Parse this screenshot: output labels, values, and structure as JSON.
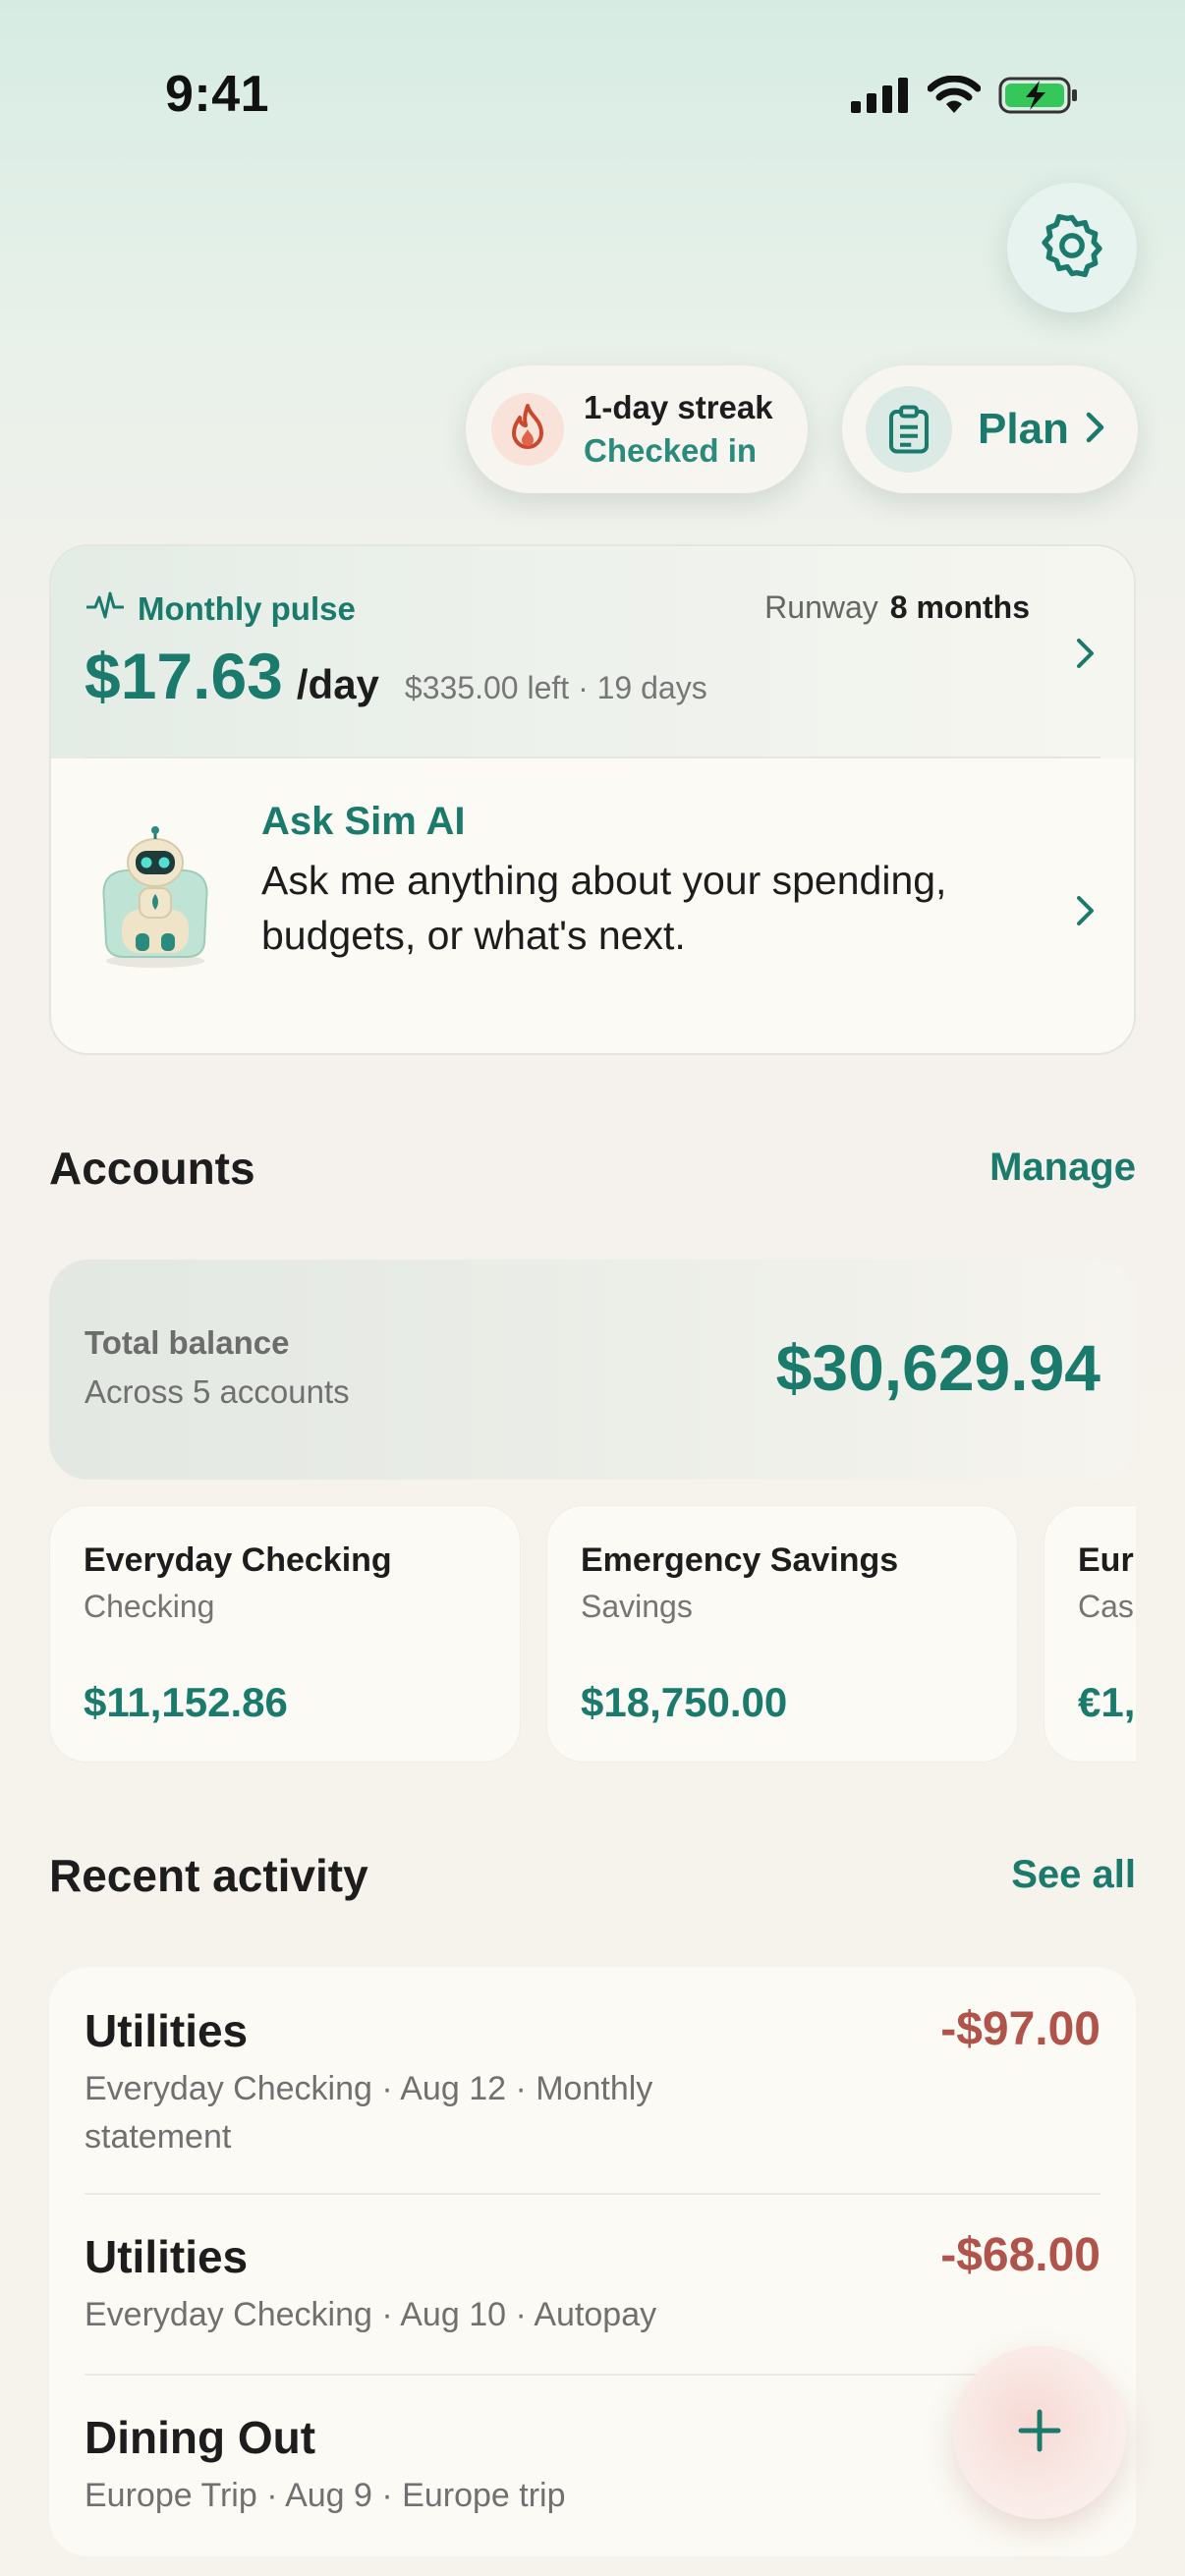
{
  "status_bar": {
    "time": "9:41"
  },
  "icons": {
    "signal": "cellular-signal-icon",
    "wifi": "wifi-icon",
    "battery": "battery-charging-icon",
    "settings": "gear-icon",
    "streak": "flame-icon",
    "plan": "clipboard-icon",
    "pulse": "heartbeat-icon",
    "chevron": "chevron-right-icon",
    "add": "plus-icon"
  },
  "streak": {
    "title": "1-day streak",
    "subtitle": "Checked in"
  },
  "plan": {
    "label": "Plan"
  },
  "pulse": {
    "label": "Monthly pulse",
    "runway_label": "Runway",
    "runway_value": "8 months",
    "amount": "$17.63",
    "unit": "/day",
    "meta": "$335.00 left · 19 days"
  },
  "assistant": {
    "title": "Ask Sim AI",
    "text": "Ask me anything about your spending, budgets, or what's next."
  },
  "accounts": {
    "title": "Accounts",
    "manage": "Manage",
    "total_label": "Total balance",
    "total_sub": "Across 5 accounts",
    "total_value": "$30,629.94",
    "items": [
      {
        "name": "Everyday Checking",
        "type": "Checking",
        "balance": "$11,152.86"
      },
      {
        "name": "Emergency Savings",
        "type": "Savings",
        "balance": "$18,750.00"
      },
      {
        "name": "Eur",
        "type": "Cas",
        "balance": "€1,"
      }
    ]
  },
  "activity": {
    "title": "Recent activity",
    "see_all": "See all",
    "items": [
      {
        "name": "Utilities",
        "meta": "Everyday Checking · Aug 12 · Monthly statement",
        "amount": "-$97.00"
      },
      {
        "name": "Utilities",
        "meta": "Everyday Checking · Aug 10 · Autopay",
        "amount": "-$68.00"
      },
      {
        "name": "Dining Out",
        "meta": "Europe Trip · Aug 9 · Europe trip",
        "amount": "-€"
      }
    ]
  },
  "colors": {
    "accent": "#1a7a6c",
    "negative": "#b0534b",
    "card": "#fbfaf4"
  }
}
